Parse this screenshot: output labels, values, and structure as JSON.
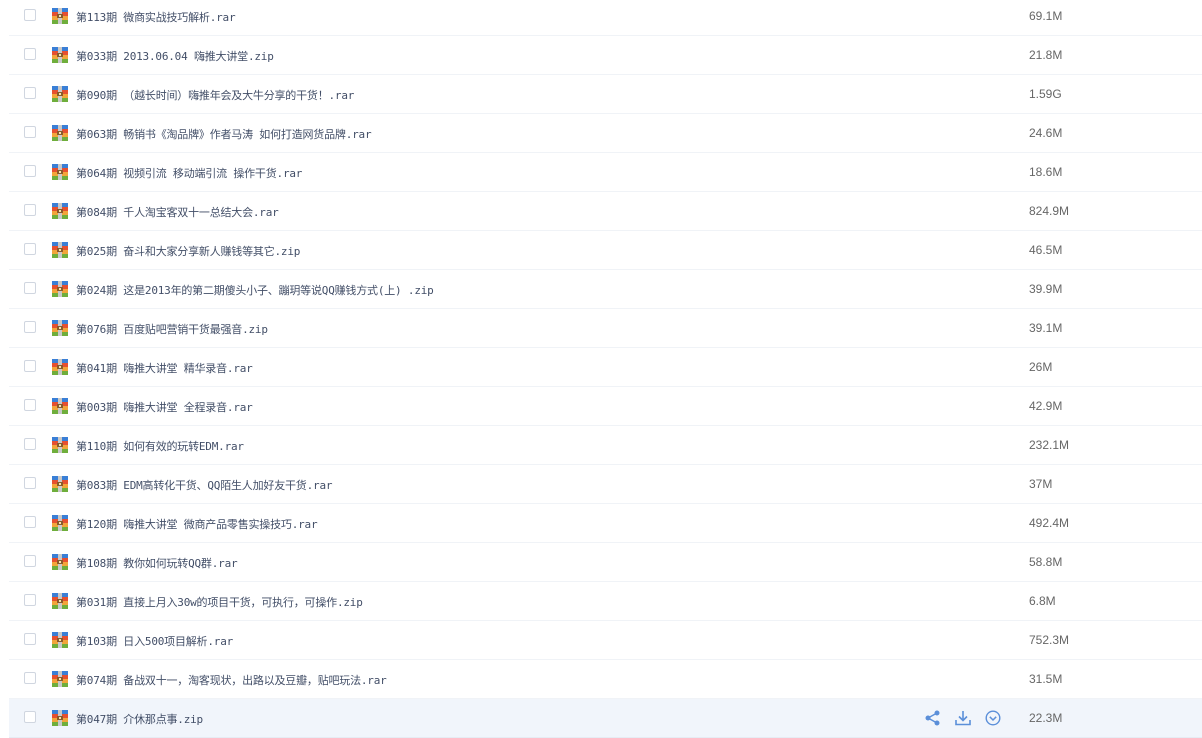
{
  "files": [
    {
      "name": "第113期 微商实战技巧解析.rar",
      "size": "69.1M"
    },
    {
      "name": "第033期 2013.06.04 嗨推大讲堂.zip",
      "size": "21.8M"
    },
    {
      "name": "第090期 （越长时间）嗨推年会及大牛分享的干货！.rar",
      "size": "1.59G"
    },
    {
      "name": "第063期 畅销书《淘品牌》作者马涛 如何打造网货品牌.rar",
      "size": "24.6M"
    },
    {
      "name": "第064期 视频引流 移动端引流 操作干货.rar",
      "size": "18.6M"
    },
    {
      "name": "第084期 千人淘宝客双十一总结大会.rar",
      "size": "824.9M"
    },
    {
      "name": "第025期 奋斗和大家分享新人赚钱等其它.zip",
      "size": "46.5M"
    },
    {
      "name": "第024期 这是2013年的第二期傻头小子、蹦玥等说QQ赚钱方式(上) .zip",
      "size": "39.9M"
    },
    {
      "name": "第076期 百度贴吧营销干货最强音.zip",
      "size": "39.1M"
    },
    {
      "name": "第041期 嗨推大讲堂 精华录音.rar",
      "size": "26M"
    },
    {
      "name": "第003期 嗨推大讲堂 全程录音.rar",
      "size": "42.9M"
    },
    {
      "name": "第110期 如何有效的玩转EDM.rar",
      "size": "232.1M"
    },
    {
      "name": "第083期 EDM高转化干货、QQ陌生人加好友干货.rar",
      "size": "37M"
    },
    {
      "name": "第120期 嗨推大讲堂 微商产品零售实操技巧.rar",
      "size": "492.4M"
    },
    {
      "name": "第108期 教你如何玩转QQ群.rar",
      "size": "58.8M"
    },
    {
      "name": "第031期 直接上月入30w的项目干货，可执行，可操作.zip",
      "size": "6.8M"
    },
    {
      "name": "第103期 日入500项目解析.rar",
      "size": "752.3M"
    },
    {
      "name": "第074期 备战双十一，淘客现状，出路以及豆瓣，贴吧玩法.rar",
      "size": "31.5M"
    },
    {
      "name": "第047期 介休那点事.zip",
      "size": "22.3M",
      "hover": true
    }
  ],
  "icons": {
    "archive": "archive-icon",
    "share": "share-icon",
    "download": "download-icon",
    "more": "more-icon"
  },
  "colors": {
    "text": "#424e67",
    "hover_bg": "#f1f5fb",
    "action_icon": "#3b8cff"
  }
}
